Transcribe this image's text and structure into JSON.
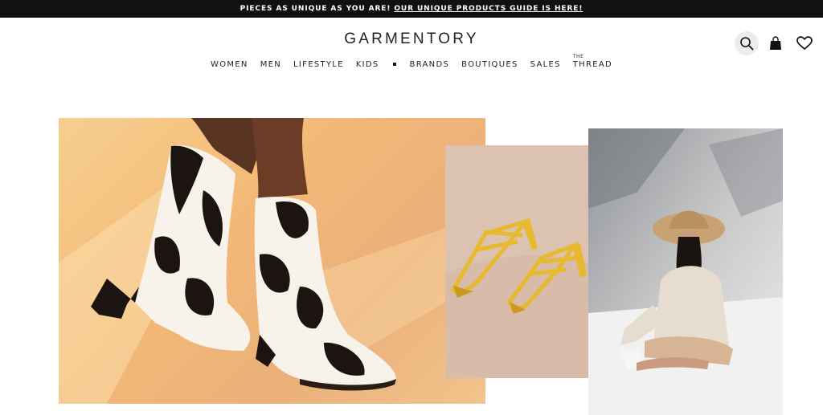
{
  "announcement": {
    "text": "PIECES AS UNIQUE AS YOU ARE!",
    "link": "OUR UNIQUE PRODUCTS GUIDE IS HERE!"
  },
  "logo": "GARMENTORY",
  "nav": {
    "women": "WOMEN",
    "men": "MEN",
    "lifestyle": "LIFESTYLE",
    "kids": "KIDS",
    "brands": "BRANDS",
    "boutiques": "BOUTIQUES",
    "sales": "SALES",
    "thread_prefix": "THE",
    "thread": "THREAD"
  },
  "icons": {
    "search": "search-icon",
    "bag": "shopping-bag-icon",
    "wishlist": "heart-icon"
  },
  "colors": {
    "announce_bg": "#111111",
    "hero_bg": "#f3b876",
    "sandal_bg": "#dcc3b1",
    "sandal": "#e7b92c",
    "boot_black": "#1c1410"
  }
}
